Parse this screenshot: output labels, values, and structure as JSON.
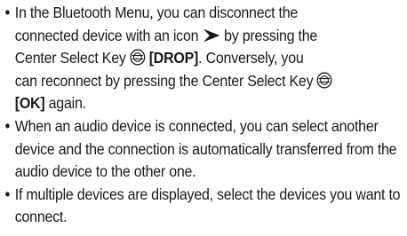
{
  "bullets": [
    {
      "t1": "In the Bluetooth Menu, you can disconnect the",
      "t2": "connected device with an icon",
      "t3": "by pressing the",
      "t4": "Center Select Key",
      "k1": "[DROP]",
      "t5": ". Conversely, you",
      "t6": "can reconnect by pressing the Center Select Key",
      "k2": "[OK]",
      "t7": "again."
    },
    {
      "text": "When an audio device is connected, you can select another device and the connection is automatically transferred from the audio device to the other one."
    },
    {
      "text": "If multiple devices are displayed, select the devices you want to connect."
    }
  ],
  "bullet_symbol": "•",
  "icons": [
    "connected-arrow-icon",
    "center-select-key-icon"
  ]
}
